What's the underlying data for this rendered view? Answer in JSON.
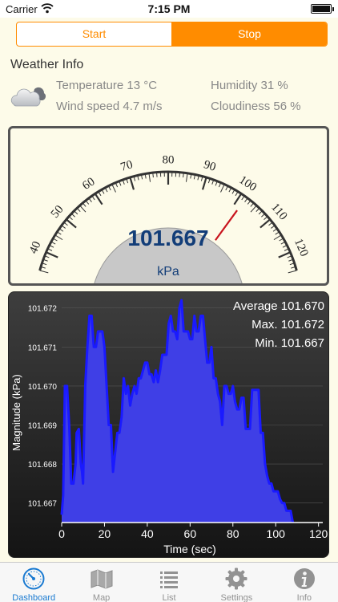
{
  "status_bar": {
    "carrier": "Carrier",
    "time": "7:15 PM"
  },
  "segment": {
    "options": [
      "Start",
      "Stop"
    ],
    "selected": "Stop"
  },
  "weather": {
    "title": "Weather Info",
    "icon": "cloud-icon",
    "temperature": "Temperature 13 °C",
    "humidity": "Humidity 31 %",
    "wind_speed": "Wind speed 4.7 m/s",
    "cloudiness": "Cloudiness 56 %"
  },
  "gauge": {
    "value_text": "101.667",
    "value": 101.667,
    "unit": "kPa",
    "scale_labels": [
      40,
      50,
      60,
      70,
      80,
      90,
      100,
      110,
      120
    ],
    "scale_min": 35,
    "scale_max": 125,
    "needle_color": "#c8141e"
  },
  "chart_data": {
    "type": "area",
    "xlabel": "Time (sec)",
    "ylabel": "Magnitude (kPa)",
    "xlim": [
      0,
      122
    ],
    "ylim": [
      101.6665,
      101.6722
    ],
    "x_ticks": [
      0,
      20,
      40,
      60,
      80,
      100,
      120
    ],
    "y_ticks": [
      101.667,
      101.668,
      101.669,
      101.67,
      101.671,
      101.672
    ],
    "y_tick_labels": [
      "101.667",
      "101.668",
      "101.669",
      "101.670",
      "101.671",
      "101.672"
    ],
    "stats": {
      "average": "Average 101.670",
      "max": "Max. 101.672",
      "min": "Min. 101.667"
    },
    "fill_color": "#3f3fe6",
    "line_color": "#1a1aff",
    "x": [
      0,
      0.7,
      1.5,
      2.5,
      3.5,
      4.5,
      5.5,
      6.5,
      7,
      8,
      9,
      9.5,
      10,
      11,
      12,
      13,
      14,
      15,
      16,
      17,
      18,
      19,
      20,
      21,
      22,
      23,
      24,
      25,
      26,
      27,
      28,
      29,
      30,
      31,
      32,
      33,
      34,
      35,
      36,
      37,
      38,
      39,
      40,
      41,
      42,
      43,
      44,
      45,
      46,
      47,
      48,
      49,
      50,
      51,
      52,
      53,
      54,
      55,
      56,
      57,
      58,
      59,
      60,
      61,
      62,
      63,
      64,
      65,
      66,
      67,
      68,
      69,
      70,
      71,
      72,
      73,
      74,
      75,
      76,
      77,
      78,
      79,
      80,
      81,
      82,
      83,
      84,
      85,
      86,
      87,
      88,
      89,
      90,
      91,
      92,
      93,
      94,
      95,
      96,
      97,
      98,
      99,
      100,
      101,
      102,
      103,
      104,
      105,
      106,
      107,
      108,
      109,
      110,
      111,
      112,
      113,
      114,
      115,
      116,
      117,
      118,
      119,
      120,
      121,
      122
    ],
    "y": [
      101.6667,
      101.6672,
      101.67,
      101.67,
      101.669,
      101.6675,
      101.6675,
      101.668,
      101.6688,
      101.6689,
      101.668,
      101.6678,
      101.6675,
      101.67,
      101.671,
      101.6718,
      101.6718,
      101.671,
      101.671,
      101.6714,
      101.6714,
      101.6714,
      101.671,
      101.67,
      101.669,
      101.669,
      101.6678,
      101.6683,
      101.6688,
      101.6688,
      101.6692,
      101.6702,
      101.6698,
      101.67,
      101.6695,
      101.6698,
      101.67,
      101.6698,
      101.6702,
      101.6702,
      101.6704,
      101.6706,
      101.6706,
      101.6703,
      101.6703,
      101.6701,
      101.6704,
      101.6701,
      101.6704,
      101.6708,
      101.6708,
      101.6708,
      101.6716,
      101.6718,
      101.6714,
      101.6714,
      101.6712,
      101.672,
      101.6722,
      101.6714,
      101.6714,
      101.6714,
      101.6712,
      101.6712,
      101.6718,
      101.6714,
      101.6714,
      101.6718,
      101.6718,
      101.6712,
      101.6706,
      101.6706,
      101.671,
      101.6702,
      101.6702,
      101.6698,
      101.6696,
      101.669,
      101.67,
      101.67,
      101.6698,
      101.6698,
      101.67,
      101.6696,
      101.6694,
      101.6694,
      101.6697,
      101.6697,
      101.6689,
      101.6689,
      101.6689,
      101.6699,
      101.6699,
      101.6699,
      101.6699,
      101.6688,
      101.6688,
      101.668,
      101.6677,
      101.6675,
      101.6675,
      101.6673,
      101.6673,
      101.6673,
      101.6671,
      101.667,
      101.667,
      101.6668,
      101.6668,
      101.6668,
      101.6665
    ]
  },
  "tabs": [
    {
      "label": "Dashboard",
      "icon": "gauge-icon",
      "active": true
    },
    {
      "label": "Map",
      "icon": "map-icon",
      "active": false
    },
    {
      "label": "List",
      "icon": "list-icon",
      "active": false
    },
    {
      "label": "Settings",
      "icon": "gear-icon",
      "active": false
    },
    {
      "label": "Info",
      "icon": "info-icon",
      "active": false
    }
  ]
}
